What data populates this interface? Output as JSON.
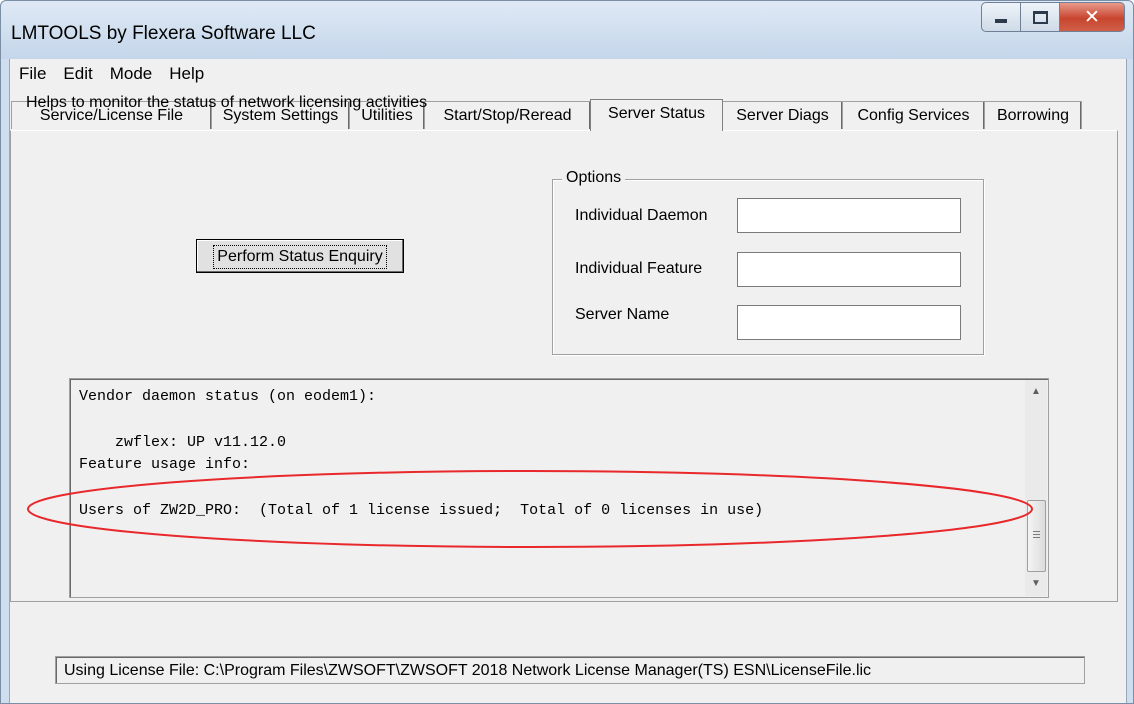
{
  "window": {
    "title": "LMTOOLS by Flexera Software LLC"
  },
  "menubar": {
    "items": [
      "File",
      "Edit",
      "Mode",
      "Help"
    ]
  },
  "tabs": [
    {
      "label": "Service/License File"
    },
    {
      "label": "System Settings"
    },
    {
      "label": "Utilities"
    },
    {
      "label": "Start/Stop/Reread"
    },
    {
      "label": "Server Status",
      "active": true
    },
    {
      "label": "Server Diags"
    },
    {
      "label": "Config Services"
    },
    {
      "label": "Borrowing"
    }
  ],
  "server_status": {
    "description": "Helps to monitor the status of network licensing activities",
    "perform_button": "Perform Status Enquiry",
    "options": {
      "legend": "Options",
      "individual_daemon_label": "Individual Daemon",
      "individual_daemon_value": "",
      "individual_feature_label": "Individual Feature",
      "individual_feature_value": "",
      "server_name_label": "Server Name",
      "server_name_value": ""
    },
    "output_lines": [
      "Vendor daemon status (on eodem1):",
      "",
      "    zwflex: UP v11.12.0",
      "Feature usage info:",
      "",
      "Users of ZW2D_PRO:  (Total of 1 license issued;  Total of 0 licenses in use)"
    ],
    "highlight_color": "#e8282b"
  },
  "statusbar": {
    "text": "Using License File:  C:\\Program Files\\ZWSOFT\\ZWSOFT 2018 Network License Manager(TS) ESN\\LicenseFile.lic"
  }
}
